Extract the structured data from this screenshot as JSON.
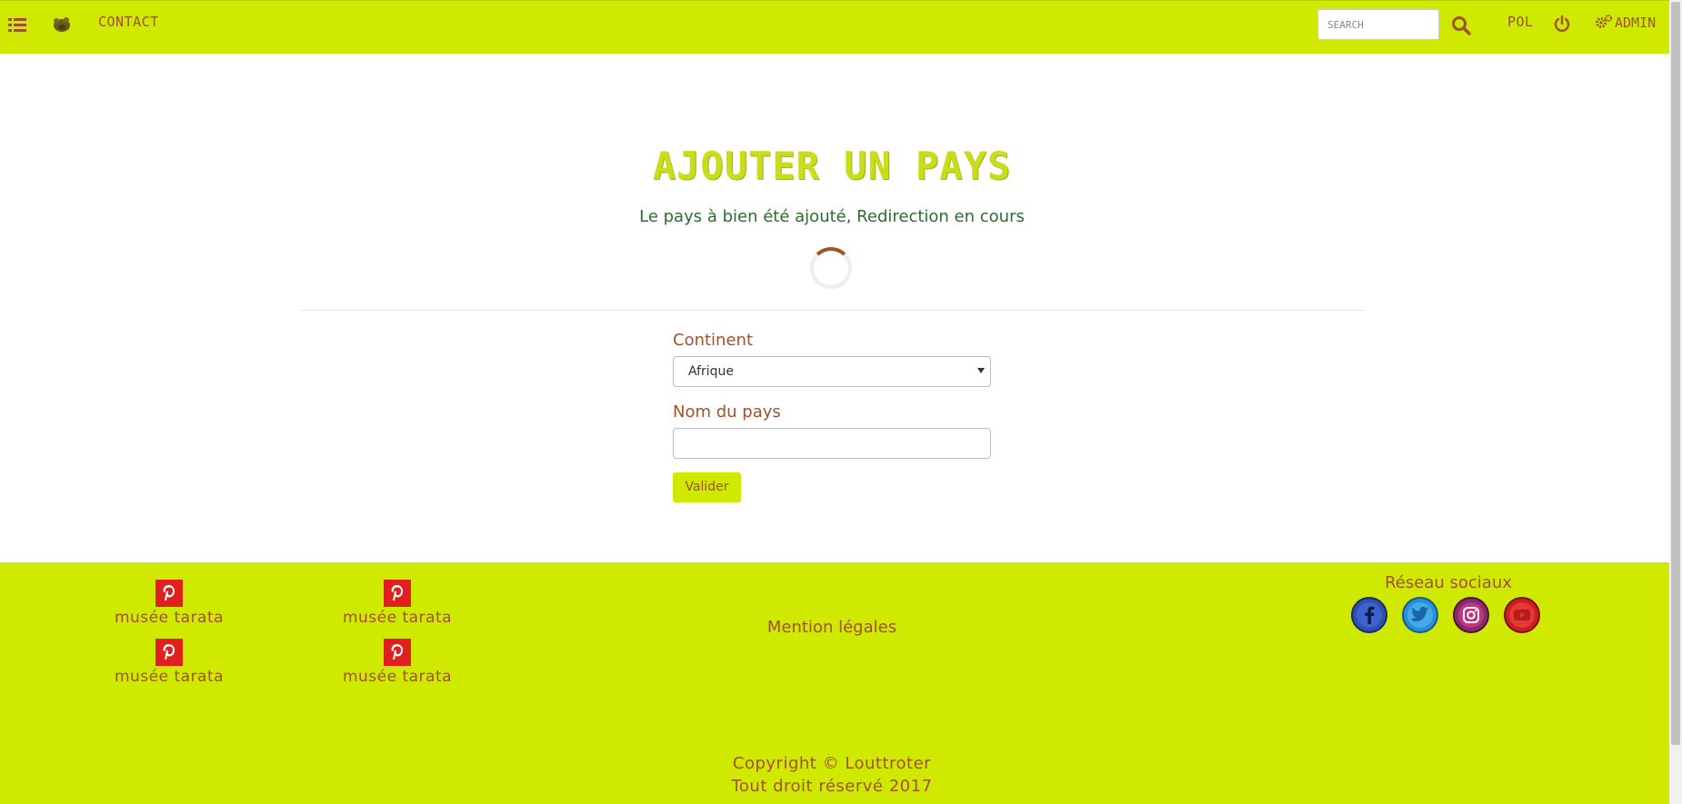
{
  "navbar": {
    "menu_icon": "list-icon",
    "logo_icon": "animal-logo-icon",
    "contact_label": "Contact",
    "search_placeholder": "SEARCH",
    "search_icon": "search-icon",
    "lang_label": "POL",
    "power_icon": "power-icon",
    "admin_label": "Admin",
    "admin_icon": "gears-icon"
  },
  "main": {
    "title": "Ajouter un pays",
    "success_message": "Le pays à bien été ajouté, Redirection en cours",
    "continent_label": "Continent",
    "continent_selected": "Afrique",
    "country_label": "Nom du pays",
    "country_value": "",
    "submit_label": "Valider"
  },
  "footer": {
    "partners": [
      {
        "label": "musée tarata",
        "icon": "pinterest-icon"
      },
      {
        "label": "musée tarata",
        "icon": "pinterest-icon"
      },
      {
        "label": "musée tarata",
        "icon": "pinterest-icon"
      },
      {
        "label": "musée tarata",
        "icon": "pinterest-icon"
      }
    ],
    "mention_label": "Mention légales",
    "social_title": "Réseau sociaux",
    "social_icons": [
      "facebook-icon",
      "twitter-icon",
      "instagram-icon",
      "youtube-icon"
    ],
    "copyright": "Copyright © Louttroter",
    "rights": "Tout droit réservé 2017"
  },
  "colors": {
    "accent": "#cfea00",
    "brown": "#a0522d",
    "title": "#c8de1a",
    "success": "#2e6b2e",
    "pinterest": "#e0201e"
  }
}
